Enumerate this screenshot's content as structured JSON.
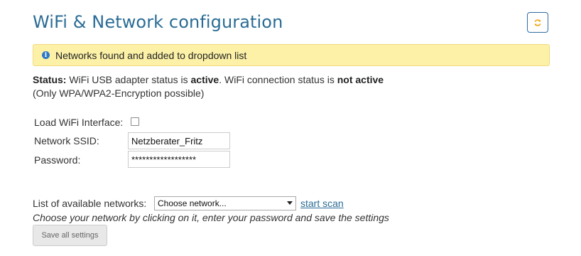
{
  "page": {
    "title": "WiFi & Network configuration",
    "refresh_icon": "refresh-icon"
  },
  "alert": {
    "icon": "info-icon",
    "icon_glyph": "i",
    "message": "Networks found and added to dropdown list",
    "background": "#fcf1a7"
  },
  "status": {
    "label": "Status:",
    "text1": " WiFi USB adapter status is ",
    "adapter_status": "active",
    "text2": ". WiFi connection status is ",
    "connection_status": "not active",
    "note": "(Only WPA/WPA2-Encryption possible)"
  },
  "form": {
    "load_wifi_label": "Load WiFi Interface:",
    "load_wifi_checked": false,
    "ssid_label": "Network SSID:",
    "ssid_value": "Netzberater_Fritz",
    "password_label": "Password:",
    "password_value": "******************"
  },
  "networks": {
    "label": "List of available networks:",
    "selected": "Choose network...",
    "scan_link": "start scan",
    "hint": "Choose your network by clicking on it, enter your password and save the settings"
  },
  "actions": {
    "save_label": "Save all settings"
  },
  "colors": {
    "accent": "#2a6c95",
    "refresh_icon": "#f0a30a"
  }
}
